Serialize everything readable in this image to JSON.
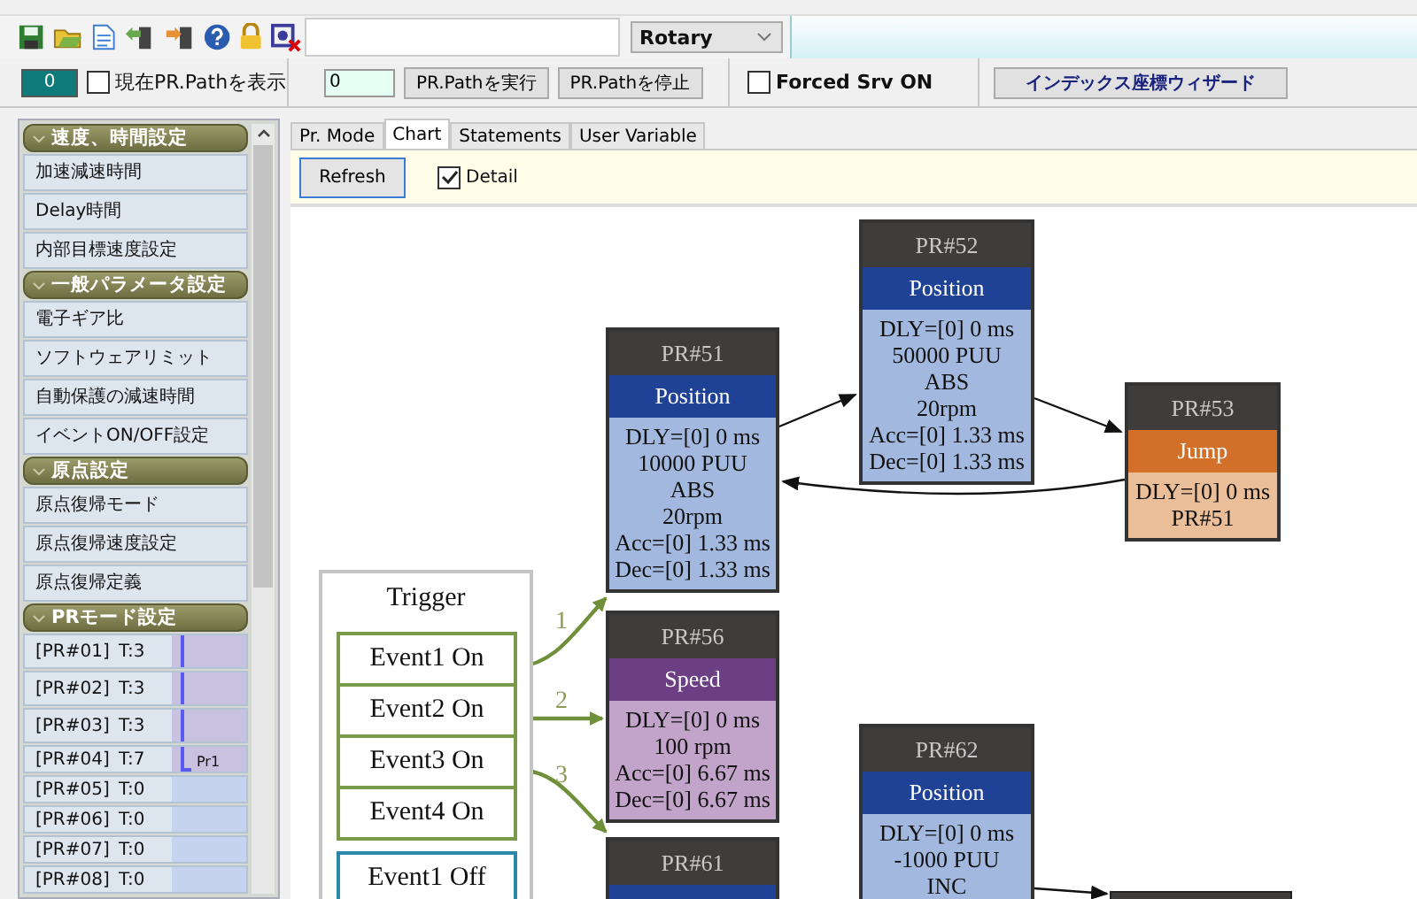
{
  "toolbar": {
    "mode_dropdown": {
      "value": "Rotary"
    }
  },
  "control_bar": {
    "current_pr": "0",
    "show_path": {
      "label": "現在PR.Pathを表示",
      "checked": false
    },
    "path_input": {
      "value": "0"
    },
    "buttons": [
      "PR.Pathを実行",
      "PR.Pathを停止"
    ],
    "forced_srv": {
      "label": "Forced Srv ON",
      "checked": false
    },
    "wizard_button": "インデックス座標ウィザード"
  },
  "sidebar": {
    "groups": [
      {
        "title": "速度、時間設定",
        "items": [
          "加速減速時間",
          "Delay時間",
          "内部目標速度設定"
        ]
      },
      {
        "title": "一般パラメータ設定",
        "items": [
          "電子ギア比",
          "ソフトウェアリミット",
          "自動保護の減速時間",
          "イベントON/OFF設定"
        ]
      },
      {
        "title": "原点設定",
        "items": [
          "原点復帰モード",
          "原点復帰速度設定",
          "原点復帰定義"
        ]
      },
      {
        "title": "PRモード設定"
      }
    ],
    "pr_rows": [
      {
        "label": "[PR#01]",
        "type": "T:3",
        "kind": "line"
      },
      {
        "label": "[PR#02]",
        "type": "T:3",
        "kind": "line"
      },
      {
        "label": "[PR#03]",
        "type": "T:3",
        "kind": "line"
      },
      {
        "label": "[PR#04]",
        "type": "T:7",
        "kind": "end",
        "tag": "Pr1"
      },
      {
        "label": "[PR#05]",
        "type": "T:0",
        "kind": "empty"
      },
      {
        "label": "[PR#06]",
        "type": "T:0",
        "kind": "empty"
      },
      {
        "label": "[PR#07]",
        "type": "T:0",
        "kind": "empty"
      },
      {
        "label": "[PR#08]",
        "type": "T:0",
        "kind": "empty"
      }
    ]
  },
  "tabs": [
    {
      "label": "Pr. Mode",
      "selected": false
    },
    {
      "label": "Chart",
      "selected": true
    },
    {
      "label": "Statements",
      "selected": false
    },
    {
      "label": "User Variable",
      "selected": false
    }
  ],
  "chart_toolbar": {
    "refresh_button": "Refresh",
    "detail": {
      "label": "Detail",
      "checked": true
    }
  },
  "diagram": {
    "trigger": {
      "title": "Trigger",
      "events": [
        {
          "label": "Event1 On",
          "kind": "on"
        },
        {
          "label": "Event2 On",
          "kind": "on"
        },
        {
          "label": "Event3 On",
          "kind": "on"
        },
        {
          "label": "Event4 On",
          "kind": "on"
        },
        {
          "label": "Event1 Off",
          "kind": "off"
        }
      ]
    },
    "edges": [
      "1",
      "2",
      "3"
    ],
    "nodes": [
      {
        "title": "PR#51",
        "type": "Position",
        "kind": "position",
        "lines": [
          "DLY=[0] 0 ms",
          "10000 PUU",
          "ABS",
          "20rpm",
          "Acc=[0] 1.33 ms",
          "Dec=[0] 1.33 ms"
        ]
      },
      {
        "title": "PR#52",
        "type": "Position",
        "kind": "position",
        "lines": [
          "DLY=[0] 0 ms",
          "50000 PUU",
          "ABS",
          "20rpm",
          "Acc=[0] 1.33 ms",
          "Dec=[0] 1.33 ms"
        ]
      },
      {
        "title": "PR#53",
        "type": "Jump",
        "kind": "jump",
        "lines": [
          "DLY=[0] 0 ms",
          "PR#51"
        ]
      },
      {
        "title": "PR#56",
        "type": "Speed",
        "kind": "speed",
        "lines": [
          "DLY=[0] 0 ms",
          "100 rpm",
          "Acc=[0] 6.67 ms",
          "Dec=[0] 6.67 ms"
        ]
      },
      {
        "title": "PR#61",
        "kind": "position"
      },
      {
        "title": "PR#62",
        "type": "Position",
        "kind": "position",
        "lines": [
          "DLY=[0] 0 ms",
          "-1000 PUU",
          "INC"
        ]
      }
    ]
  }
}
